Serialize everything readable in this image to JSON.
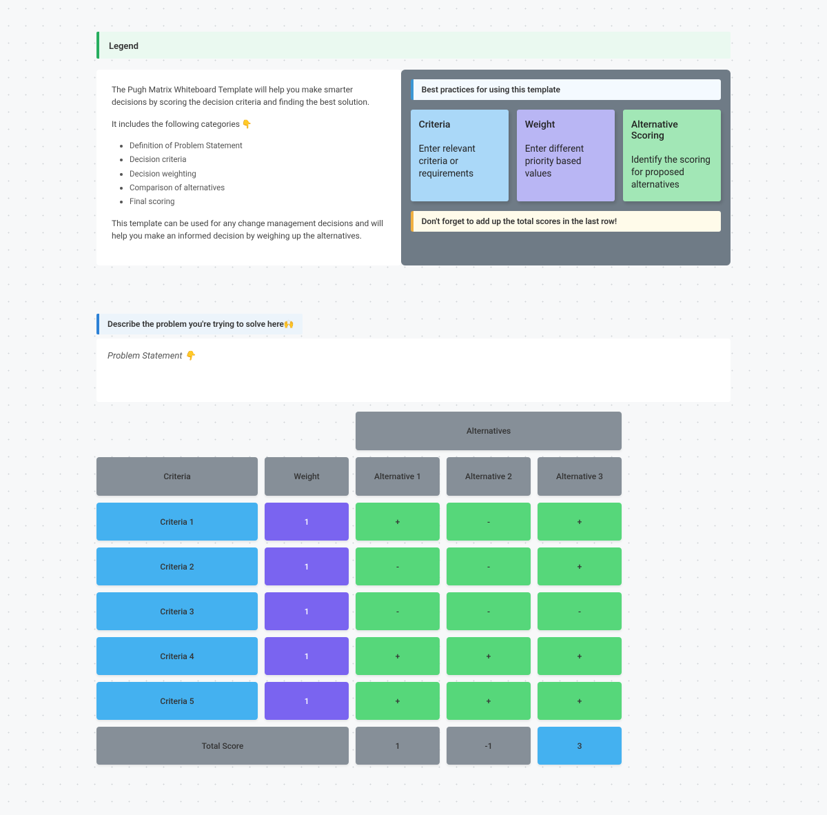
{
  "legend": {
    "label": "Legend"
  },
  "intro": {
    "p1": "The Pugh Matrix Whiteboard Template will help you make smarter decisions by scoring the decision criteria and finding the best solution.",
    "p2": "It includes the following categories 👇",
    "bullets": [
      "Definition of Problem Statement",
      "Decision criteria",
      "Decision weighting",
      "Comparison of alternatives",
      "Final scoring"
    ],
    "p3": "This template can be used for any change management decisions and will help you make an informed decision by weighing up the alternatives."
  },
  "guidance": {
    "tip_top": "Best practices for using this template",
    "cards": [
      {
        "title": "Criteria",
        "body": "Enter relevant criteria or requirements"
      },
      {
        "title": "Weight",
        "body": "Enter different priority based values"
      },
      {
        "title": "Alternative Scoring",
        "body": "Identify the scoring for proposed alternatives"
      }
    ],
    "tip_bottom": "Don't forget to add up the total scores in the last row!"
  },
  "problem": {
    "callout": "Describe the problem you're trying to solve here🙌",
    "label": "Problem Statement  👇"
  },
  "matrix": {
    "alt_header": "Alternatives",
    "headers": {
      "criteria": "Criteria",
      "weight": "Weight",
      "alt1": "Alternative 1",
      "alt2": "Alternative 2",
      "alt3": "Alternative 3"
    },
    "rows": [
      {
        "criteria": "Criteria 1",
        "weight": "1",
        "alt1": "+",
        "alt2": "-",
        "alt3": "+"
      },
      {
        "criteria": "Criteria 2",
        "weight": "1",
        "alt1": "-",
        "alt2": "-",
        "alt3": "+"
      },
      {
        "criteria": "Criteria 3",
        "weight": "1",
        "alt1": "-",
        "alt2": "-",
        "alt3": "-"
      },
      {
        "criteria": "Criteria 4",
        "weight": "1",
        "alt1": "+",
        "alt2": "+",
        "alt3": "+"
      },
      {
        "criteria": "Criteria 5",
        "weight": "1",
        "alt1": "+",
        "alt2": "+",
        "alt3": "+"
      }
    ],
    "total": {
      "label": "Total Score",
      "alt1": "1",
      "alt2": "-1",
      "alt3": "3"
    }
  }
}
